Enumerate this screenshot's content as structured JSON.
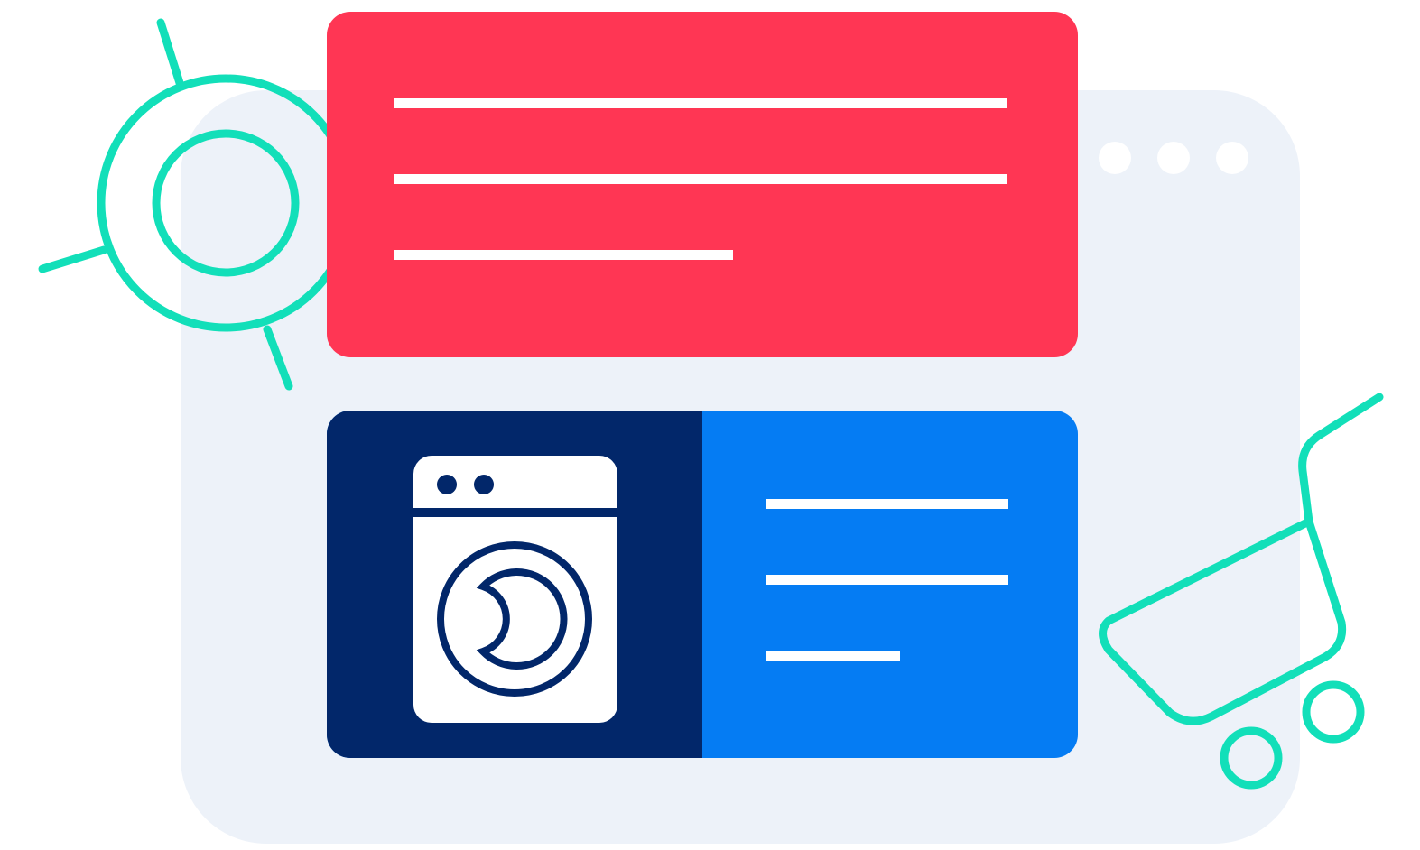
{
  "colors": {
    "background": "#ffffff",
    "browser_panel": "#edf2f9",
    "browser_dots": "#ffffff",
    "red_card": "#ff3654",
    "navy_panel": "#02276a",
    "blue_panel": "#057cf3",
    "accent_outline": "#12dfb9",
    "lines": "#ffffff"
  },
  "icons": {
    "sun": "sun-icon",
    "washing_machine": "washing-machine-icon",
    "cart": "shopping-cart-icon"
  }
}
